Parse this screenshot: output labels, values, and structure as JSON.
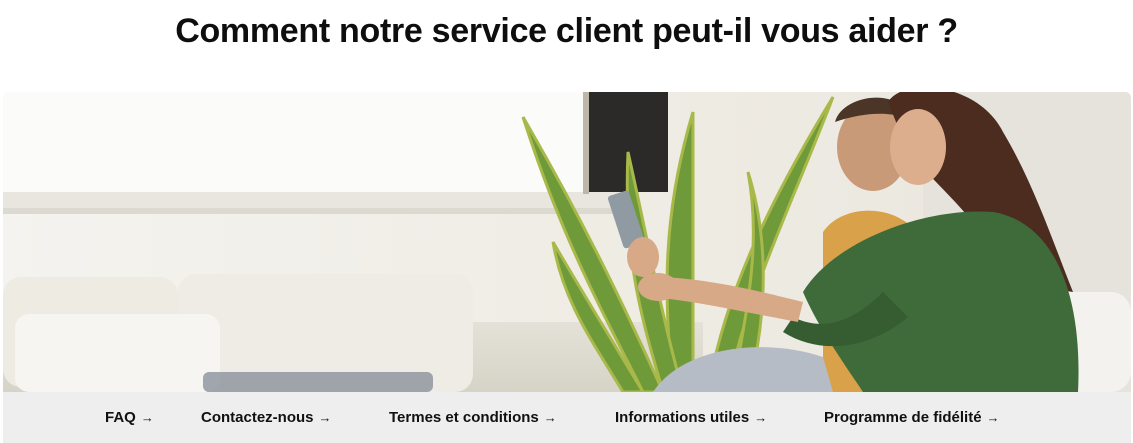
{
  "header": {
    "title": "Comment notre service client peut-il vous aider ?"
  },
  "hero": {
    "image_semantic": "couple-with-tablet-photo"
  },
  "nav": {
    "links": [
      {
        "label": "FAQ",
        "arrow": "→"
      },
      {
        "label": "Contactez-nous",
        "arrow": "→"
      },
      {
        "label": "Termes et conditions",
        "arrow": "→"
      },
      {
        "label": "Informations utiles",
        "arrow": "→"
      },
      {
        "label": "Programme de fidélité",
        "arrow": "→"
      }
    ]
  },
  "colors": {
    "nav_background": "#eeeeee",
    "title_text": "#0e0e0e",
    "shirt_green": "#3f6b3a"
  }
}
